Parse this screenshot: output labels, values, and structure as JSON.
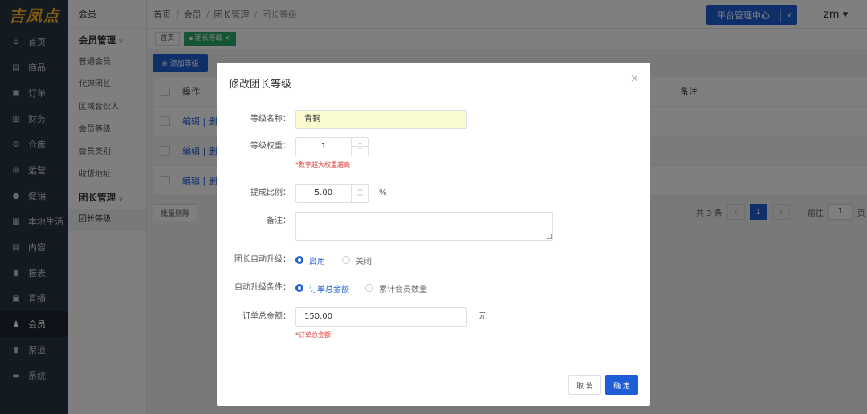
{
  "sidebar": {
    "logo": "吉凤点",
    "items": [
      {
        "label": "首页",
        "icon": "home-icon",
        "glyph": "⌂"
      },
      {
        "label": "商品",
        "icon": "cart-icon",
        "glyph": "▤"
      },
      {
        "label": "订单",
        "icon": "order-icon",
        "glyph": "▣"
      },
      {
        "label": "财务",
        "icon": "finance-icon",
        "glyph": "▥"
      },
      {
        "label": "仓库",
        "icon": "warehouse-icon",
        "glyph": "⚙"
      },
      {
        "label": "运营",
        "icon": "operation-icon",
        "glyph": "◍"
      },
      {
        "label": "促销",
        "icon": "promotion-icon",
        "glyph": "●"
      },
      {
        "label": "本地生活",
        "icon": "local-life-icon",
        "glyph": "▦"
      },
      {
        "label": "内容",
        "icon": "content-icon",
        "glyph": "▤"
      },
      {
        "label": "报表",
        "icon": "report-icon",
        "glyph": "▮"
      },
      {
        "label": "直播",
        "icon": "live-icon",
        "glyph": "▣"
      },
      {
        "label": "会员",
        "icon": "member-icon",
        "glyph": "♟"
      },
      {
        "label": "渠道",
        "icon": "channel-icon",
        "glyph": "▮"
      },
      {
        "label": "系统",
        "icon": "system-icon",
        "glyph": "▬"
      }
    ]
  },
  "subnav": {
    "title": "会员",
    "group1": {
      "label": "会员管理",
      "chevron": "∨"
    },
    "group1_items": [
      "普通会员",
      "代理团长",
      "区域合伙人",
      "会员等级",
      "会员类别",
      "收货地址"
    ],
    "group2": {
      "label": "团长管理",
      "chevron": "∨"
    },
    "group2_items": [
      "团长等级"
    ]
  },
  "header": {
    "breadcrumb": [
      "首页",
      "会员",
      "团长管理",
      "团长等级"
    ],
    "platform_button": "平台管理中心",
    "platform_dropdown": "∨",
    "user": "zm ▾"
  },
  "tags": [
    "首页",
    "团长等级 ×"
  ],
  "content": {
    "add_button": "⊕ 添加等级",
    "table_header": {
      "op": "操作",
      "note": "备注"
    },
    "rows": [
      {
        "op": "编辑 | 删"
      },
      {
        "op": "编辑 | 删"
      },
      {
        "op": "编辑 | 删"
      }
    ],
    "batch_delete": "批量删除",
    "pager": {
      "total": "共 3 条",
      "prev": "‹",
      "current": "1",
      "next": "›",
      "goto": "前往",
      "page_input": "1",
      "page_unit": "页"
    }
  },
  "modal": {
    "title": "修改团长等级",
    "close": "×",
    "level_name_label": "等级名称：",
    "level_name_value": "青铜",
    "weight_label": "等级权重：",
    "weight_value": "1",
    "weight_hint": "*数字越大权重越高",
    "commission_label": "提成比例：",
    "commission_value": "5.00",
    "commission_suffix": "%",
    "note_label": "备注：",
    "auto_upgrade_label": "团长自动升级：",
    "auto_upgrade_on": "启用",
    "auto_upgrade_off": "关闭",
    "condition_label": "自动升级条件：",
    "condition_order_total": "订单总金额",
    "condition_member_count": "累计会员数量",
    "order_total_label": "订单总金额：",
    "order_total_value": "150.00",
    "order_total_suffix": "元",
    "order_total_hint": "*订单总金额",
    "cancel": "取 消",
    "confirm": "确 定",
    "spin_up": "︿",
    "spin_down": "﹀"
  }
}
